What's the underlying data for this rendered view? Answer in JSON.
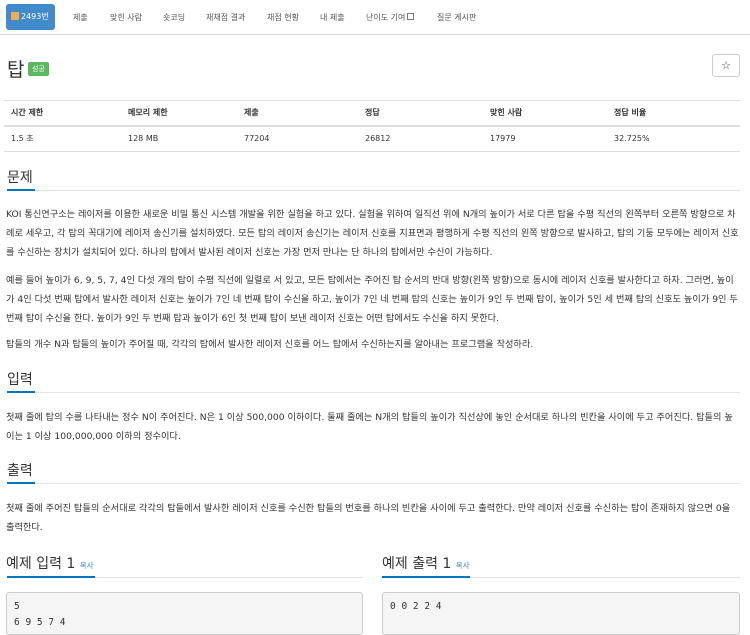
{
  "nav": {
    "problem_id": "2493번",
    "items": [
      "제출",
      "맞힌 사람",
      "숏코딩",
      "재채점 결과",
      "채점 현황",
      "내 제출",
      "난이도 기여",
      "질문 게시판"
    ]
  },
  "problem": {
    "title": "탑",
    "status": "성공",
    "star": "☆"
  },
  "stats": {
    "headers": [
      "시간 제한",
      "메모리 제한",
      "제출",
      "정답",
      "맞힌 사람",
      "정답 비율"
    ],
    "values": [
      "1.5 초",
      "128 MB",
      "77204",
      "26812",
      "17979",
      "32.725%"
    ]
  },
  "sections": {
    "description_title": "문제",
    "description": [
      "KOI 통신연구소는 레이저를 이용한 새로운 비밀 통신 시스템 개발을 위한 실험을 하고 있다. 실험을 위하여 일직선 위에 N개의 높이가 서로 다른 탑을 수평 직선의 왼쪽부터 오른쪽 방향으로 차례로 세우고, 각 탑의 꼭대기에 레이저 송신기를 설치하였다. 모든 탑의 레이저 송신기는 레이저 신호를 지표면과 평행하게 수평 직선의 왼쪽 방향으로 발사하고, 탑의 기둥 모두에는 레이저 신호를 수신하는 장치가 설치되어 있다. 하나의 탑에서 발사된 레이저 신호는 가장 먼저 만나는 단 하나의 탑에서만 수신이 가능하다.",
      "예를 들어 높이가 6, 9, 5, 7, 4인 다섯 개의 탑이 수평 직선에 일렬로 서 있고, 모든 탑에서는 주어진 탑 순서의 반대 방향(왼쪽 방향)으로 동시에 레이저 신호를 발사한다고 하자. 그러면, 높이가 4인 다섯 번째 탑에서 발사한 레이저 신호는 높이가 7인 네 번째 탑이 수신을 하고, 높이가 7인 네 번째 탑의 신호는 높이가 9인 두 번째 탑이, 높이가 5인 세 번째 탑의 신호도 높이가 9인 두 번째 탑이 수신을 한다. 높이가 9인 두 번째 탑과 높이가 6인 첫 번째 탑이 보낸 레이저 신호는 어떤 탑에서도 수신을 하지 못한다.",
      "탑들의 개수 N과 탑들의 높이가 주어질 때, 각각의 탑에서 발사한 레이저 신호를 어느 탑에서 수신하는지를 알아내는 프로그램을 작성하라."
    ],
    "input_title": "입력",
    "input": "첫째 줄에 탑의 수를 나타내는 정수 N이 주어진다. N은 1 이상 500,000 이하이다. 둘째 줄에는 N개의 탑들의 높이가 직선상에 놓인 순서대로 하나의 빈칸을 사이에 두고 주어진다. 탑들의 높이는 1 이상 100,000,000 이하의 정수이다.",
    "output_title": "출력",
    "output": "첫째 줄에 주어진 탑들의 순서대로 각각의 탑들에서 발사한 레이저 신호를 수신한 탑들의 번호를 하나의 빈칸을 사이에 두고 출력한다. 만약 레이저 신호를 수신하는 탑이 존재하지 않으면 0을 출력한다."
  },
  "samples": {
    "input_title": "예제 입력 1",
    "output_title": "예제 출력 1",
    "copy_label": "복사",
    "input_text": "5\n6 9 5 7 4",
    "output_text": "0 0 2 2 4"
  }
}
